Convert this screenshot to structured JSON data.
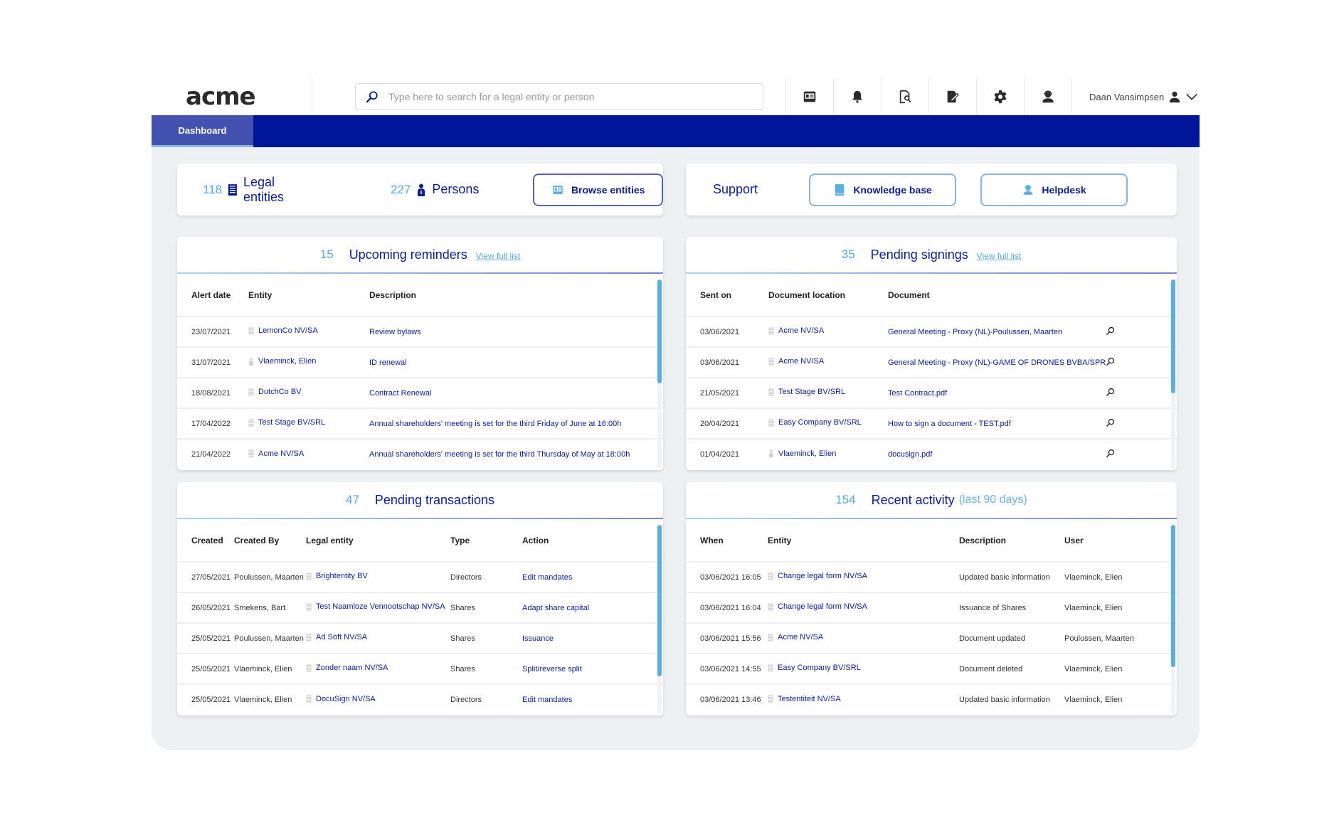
{
  "app": {
    "logo": "acme",
    "search": {
      "placeholder": "Type here to search for a legal entity or person",
      "value": ""
    },
    "toolbar_icons": [
      "entities-icon",
      "bell-icon",
      "document-search-icon",
      "document-edit-icon",
      "gear-icon",
      "helpdesk-icon"
    ],
    "user": {
      "name": "Daan Vansimpsen"
    },
    "nav": {
      "tabs": [
        {
          "label": "Dashboard",
          "active": true
        }
      ]
    },
    "colors": {
      "brand": "#00169a",
      "accent": "#55a8dc",
      "link": "#0c1d8f"
    }
  },
  "summary": {
    "legal_entities": {
      "count": "118",
      "label": "Legal entities"
    },
    "persons": {
      "count": "227",
      "label": "Persons"
    },
    "browse_button": "Browse entities"
  },
  "support": {
    "label": "Support",
    "knowledge_base_button": "Knowledge base",
    "helpdesk_button": "Helpdesk"
  },
  "reminders": {
    "count": "15",
    "title": "Upcoming reminders",
    "link": "View full list",
    "columns": [
      "Alert date",
      "Entity",
      "Description"
    ],
    "rows": [
      {
        "date": "23/07/2021",
        "entity": "LemonCo NV/SA",
        "entity_type": "company",
        "description": "Review bylaws"
      },
      {
        "date": "31/07/2021",
        "entity": "Vlaeminck, Elien",
        "entity_type": "person",
        "description": "ID renewal"
      },
      {
        "date": "18/08/2021",
        "entity": "DutchCo BV",
        "entity_type": "company",
        "description": "Contract Renewal"
      },
      {
        "date": "17/04/2022",
        "entity": "Test Stage BV/SRL",
        "entity_type": "company",
        "description": "Annual shareholders' meeting is set for the third Friday of June at 16:00h"
      },
      {
        "date": "21/04/2022",
        "entity": "Acme NV/SA",
        "entity_type": "company",
        "description": "Annual shareholders' meeting is set for the third Thursday of May at 18:00h"
      }
    ],
    "scroll_fraction": 0.55
  },
  "signings": {
    "count": "35",
    "title": "Pending signings",
    "link": "View full list",
    "columns": [
      "Sent on",
      "Document location",
      "Document"
    ],
    "rows": [
      {
        "date": "03/06/2021",
        "location": "Acme NV/SA",
        "location_type": "company",
        "document": "General Meeting - Proxy (NL)-Poulussen, Maarten"
      },
      {
        "date": "03/06/2021",
        "location": "Acme NV/SA",
        "location_type": "company",
        "document": "General Meeting - Proxy (NL)-GAME OF DRONES BVBA/SPRL"
      },
      {
        "date": "21/05/2021",
        "location": "Test Stage BV/SRL",
        "location_type": "company",
        "document": "Test Contract.pdf"
      },
      {
        "date": "20/04/2021",
        "location": "Easy Company BV/SRL",
        "location_type": "company",
        "document": "How to sign a document - TEST.pdf"
      },
      {
        "date": "01/04/2021",
        "location": "Vlaeminck, Elien",
        "location_type": "person",
        "document": "docusign.pdf"
      }
    ],
    "scroll_fraction": 0.6
  },
  "transactions": {
    "count": "47",
    "title": "Pending transactions",
    "columns": [
      "Created",
      "Created By",
      "Legal entity",
      "Type",
      "Action"
    ],
    "rows": [
      {
        "created": "27/05/2021",
        "by": "Poulussen, Maarten",
        "entity": "Brightentity BV",
        "type": "Directors",
        "action": "Edit mandates"
      },
      {
        "created": "26/05/2021",
        "by": "Smekens, Bart",
        "entity": "Test Naamloze Vennootschap NV/SA",
        "type": "Shares",
        "action": "Adapt share capital"
      },
      {
        "created": "25/05/2021",
        "by": "Poulussen, Maarten",
        "entity": "Ad Soft NV/SA",
        "type": "Shares",
        "action": "Issuance"
      },
      {
        "created": "25/05/2021",
        "by": "Vlaeminck, Elien",
        "entity": "Zonder naam NV/SA",
        "type": "Shares",
        "action": "Split/reverse split"
      },
      {
        "created": "25/05/2021",
        "by": "Vlaeminck, Elien",
        "entity": "DocuSign NV/SA",
        "type": "Directors",
        "action": "Edit mandates"
      }
    ],
    "scroll_fraction": 0.8
  },
  "activity": {
    "count": "154",
    "title": "Recent activity",
    "subtitle": "(last 90 days)",
    "columns": [
      "When",
      "Entity",
      "Description",
      "User"
    ],
    "rows": [
      {
        "when": "03/06/2021 16:05",
        "entity": "Change legal form NV/SA",
        "description": "Updated basic information",
        "user": "Vlaeminck, Elien"
      },
      {
        "when": "03/06/2021 16:04",
        "entity": "Change legal form NV/SA",
        "description": "Issuance of Shares",
        "user": "Vlaeminck, Elien"
      },
      {
        "when": "03/06/2021 15:56",
        "entity": "Acme NV/SA",
        "description": "Document updated",
        "user": "Poulussen, Maarten"
      },
      {
        "when": "03/06/2021 14:55",
        "entity": "Easy Company BV/SRL",
        "description": "Document deleted",
        "user": "Vlaeminck, Elien"
      },
      {
        "when": "03/06/2021 13:46",
        "entity": "Testentiteit NV/SA",
        "description": "Updated basic information",
        "user": "Vlaeminck, Elien"
      }
    ],
    "scroll_fraction": 0.75
  }
}
